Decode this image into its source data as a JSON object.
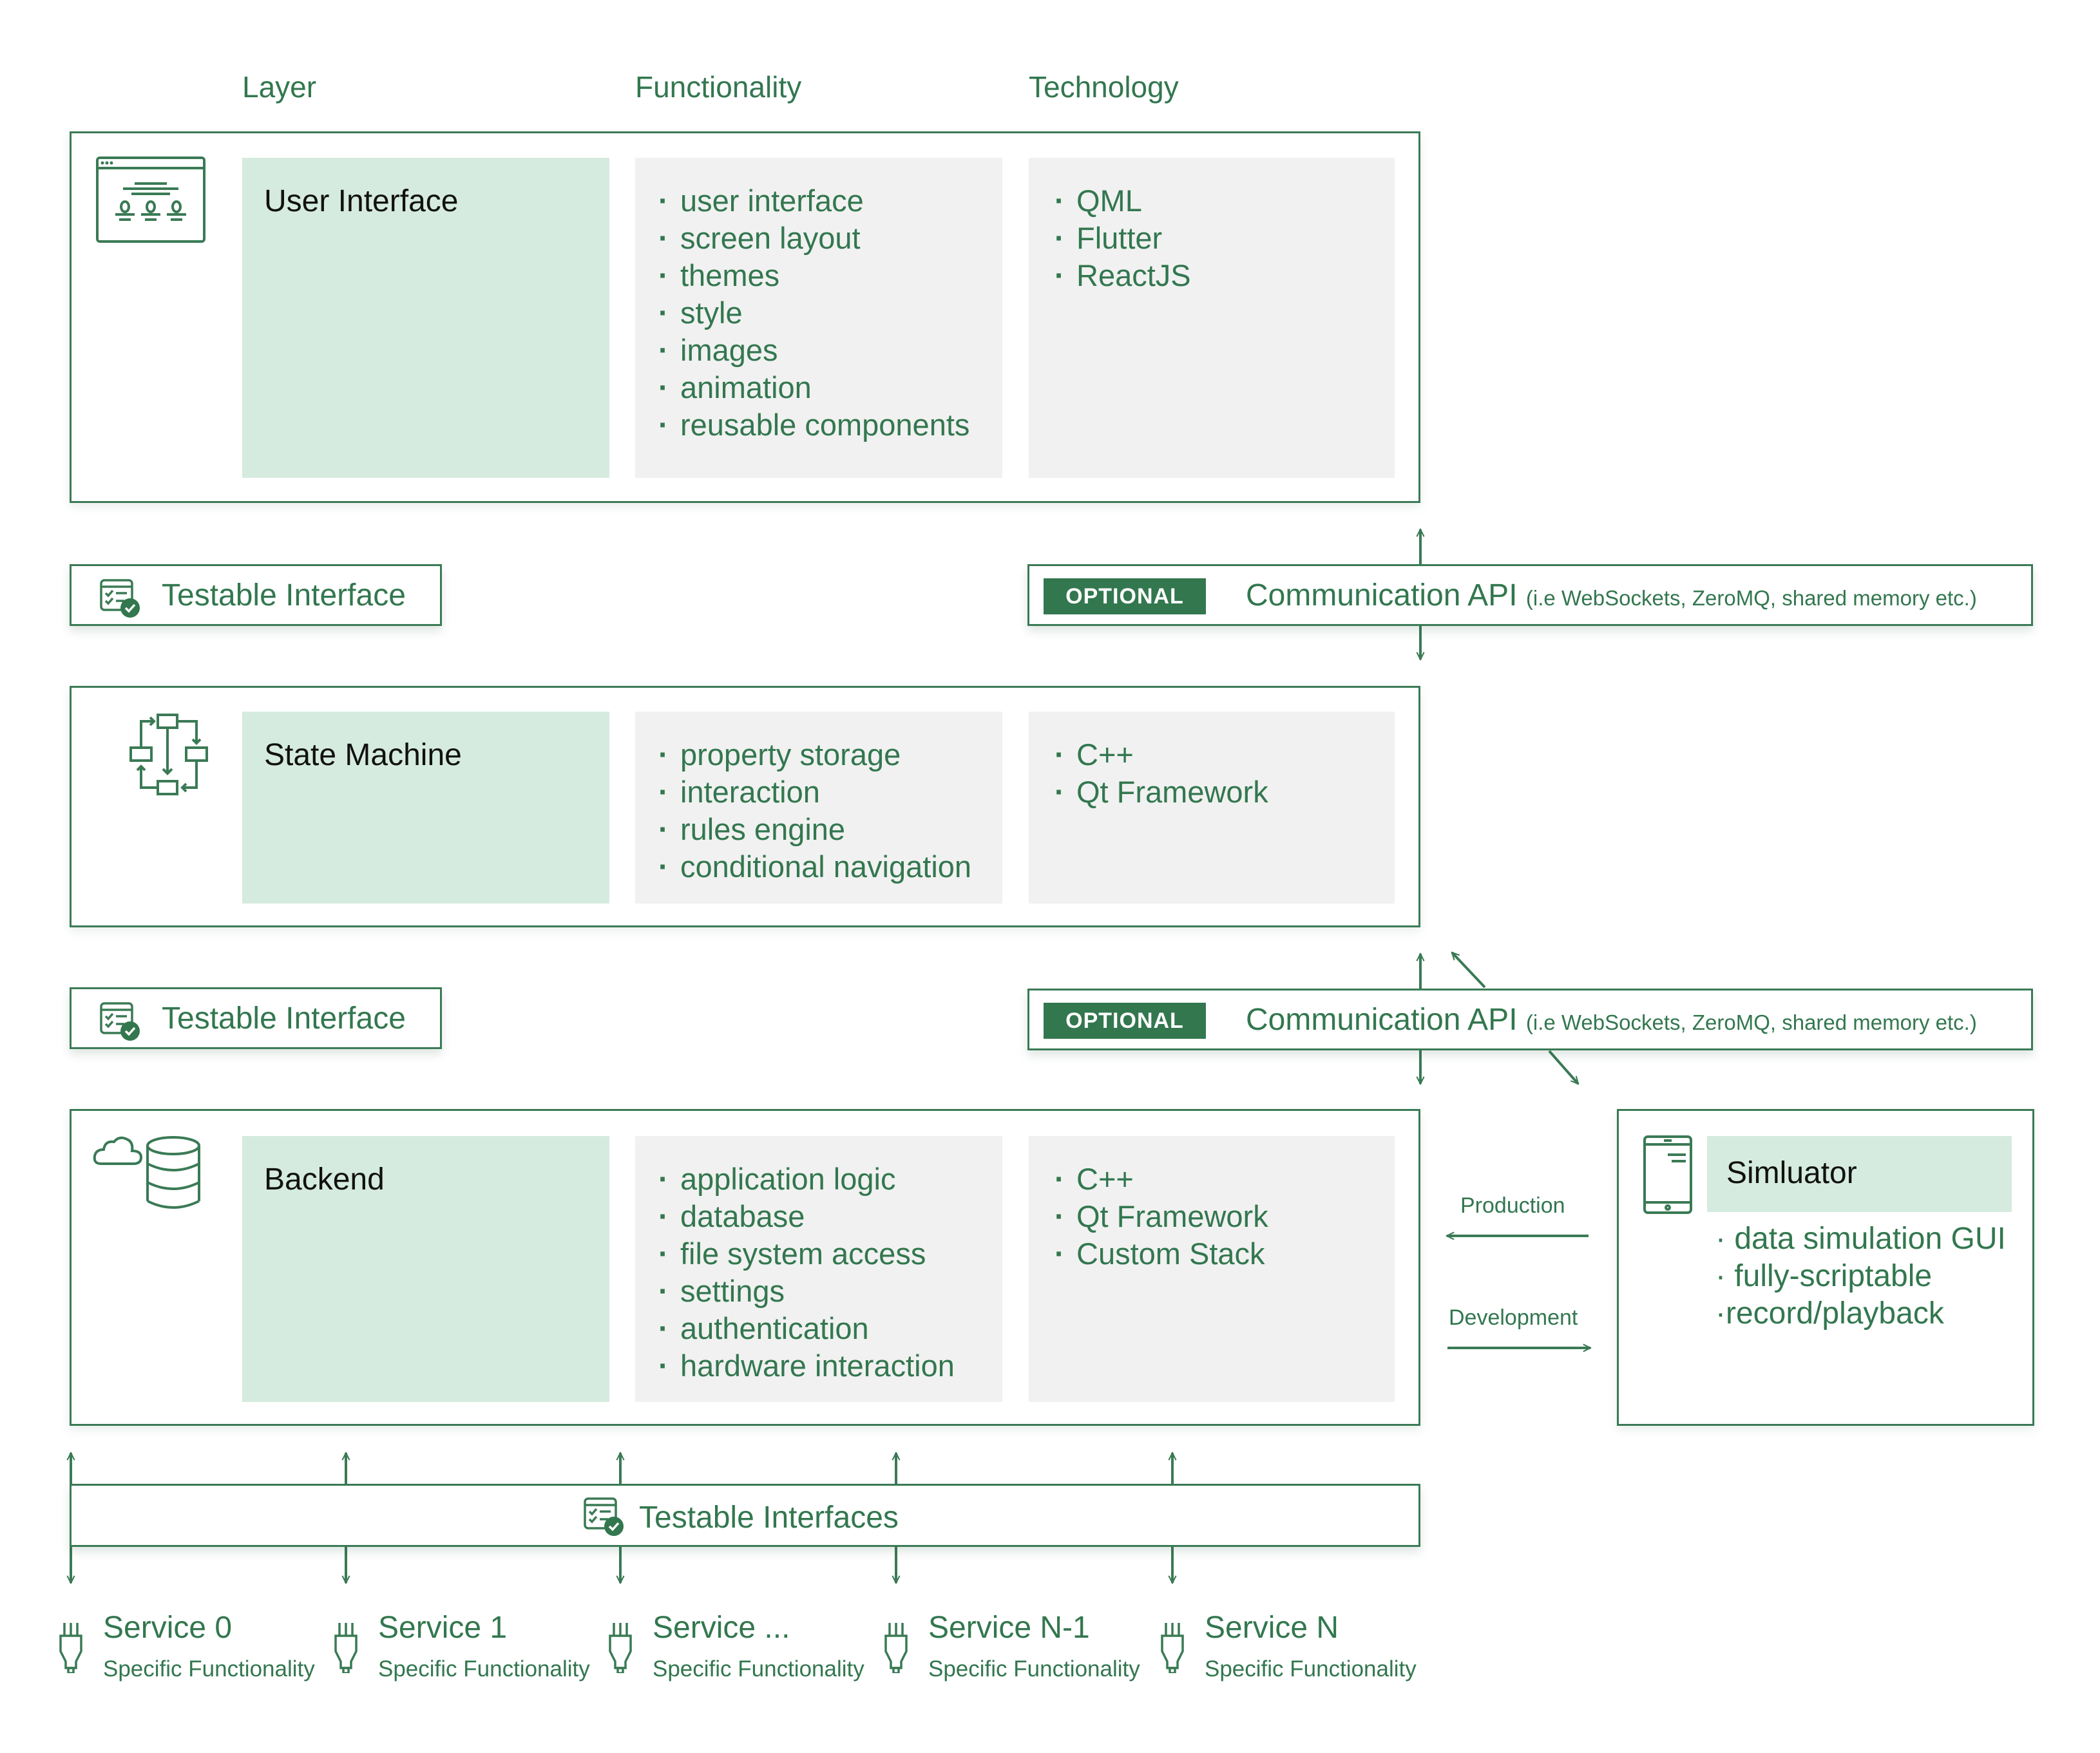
{
  "columns": {
    "layer": "Layer",
    "functionality": "Functionality",
    "technology": "Technology"
  },
  "colors": {
    "accent": "#33774f",
    "layer_panel": "#d6ebdf",
    "info_panel": "#f1f1f1",
    "badge_text": "#ffffff"
  },
  "layers": [
    {
      "icon": "browser-window-icon",
      "name": "User Interface",
      "functionality": [
        "user interface",
        "screen layout",
        "themes",
        "style",
        "images",
        "animation",
        "reusable components"
      ],
      "technology": [
        "QML",
        "Flutter",
        "ReactJS"
      ]
    },
    {
      "icon": "state-flow-icon",
      "name": "State Machine",
      "functionality": [
        "property storage",
        "interaction",
        "rules engine",
        "conditional navigation"
      ],
      "technology": [
        "C++",
        "Qt Framework"
      ]
    },
    {
      "icon": "cloud-database-icon",
      "name": "Backend",
      "functionality": [
        "application logic",
        "database",
        "file system access",
        "settings",
        "authentication",
        "hardware interaction"
      ],
      "technology": [
        "C++",
        "Qt Framework",
        "Custom Stack"
      ]
    }
  ],
  "testable_interface": {
    "label": "Testable Interface"
  },
  "communication_api": {
    "badge": "OPTIONAL",
    "title": "Communication API",
    "subtitle": "(i.e WebSockets, ZeroMQ, shared memory etc.)"
  },
  "simulator": {
    "title": "Simluator",
    "features": [
      "· data simulation GUI",
      "· fully-scriptable",
      "·record/playback"
    ]
  },
  "flows": {
    "production": "Production",
    "development": "Development"
  },
  "testable_interfaces_bar": {
    "label": "Testable Interfaces"
  },
  "services": [
    {
      "name": "Service 0",
      "desc": "Specific Functionality"
    },
    {
      "name": "Service 1",
      "desc": "Specific Functionality"
    },
    {
      "name": "Service ...",
      "desc": "Specific Functionality"
    },
    {
      "name": "Service N-1",
      "desc": "Specific Functionality"
    },
    {
      "name": "Service N",
      "desc": "Specific Functionality"
    }
  ]
}
